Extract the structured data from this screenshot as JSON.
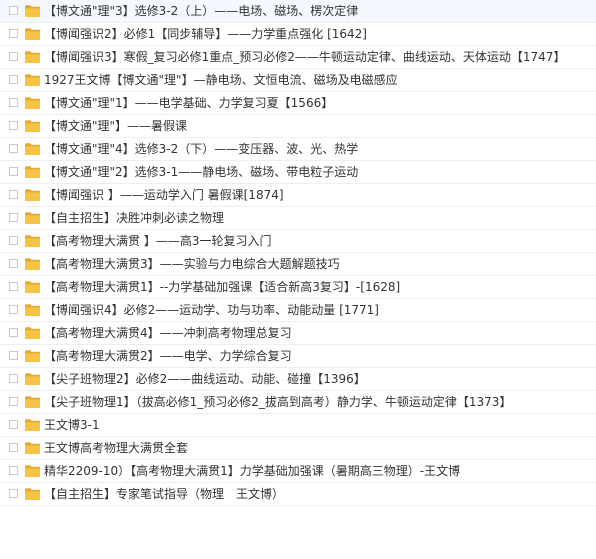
{
  "accent_colors": {
    "folder": "#f5c444",
    "folder_dark": "#e6a92f",
    "text": "#333333",
    "divider": "#eeeeee"
  },
  "file_list": {
    "items": [
      {
        "icon": "folder-icon",
        "label": "【博文通\"理\"3】选修3-2（上）——电场、磁场、楞次定律"
      },
      {
        "icon": "folder-icon",
        "label": "【博闻强识2】必修1【同步辅导】——力学重点强化 [1642]"
      },
      {
        "icon": "folder-icon",
        "label": "【博闻强识3】寒假_复习必修1重点_预习必修2——牛顿运动定律、曲线运动、天体运动【1747】"
      },
      {
        "icon": "folder-icon",
        "label": "1927王文博【博文通\"理\"】—静电场、文恒电流、磁场及电磁感应"
      },
      {
        "icon": "folder-icon",
        "label": "【博文通\"理\"1】——电学基础、力学复习夏【1566】"
      },
      {
        "icon": "folder-icon",
        "label": "【博文通\"理\"】——暑假课"
      },
      {
        "icon": "folder-icon",
        "label": "【博文通\"理\"4】选修3-2（下）——变压器、波、光、热学"
      },
      {
        "icon": "folder-icon",
        "label": "【博文通\"理\"2】选修3-1——静电场、磁场、带电粒子运动"
      },
      {
        "icon": "folder-icon",
        "label": "【博闻强识 】——运动学入门 暑假课[1874]"
      },
      {
        "icon": "folder-icon",
        "label": "【自主招生】决胜冲刺必读之物理"
      },
      {
        "icon": "folder-icon",
        "label": "【高考物理大满贯 】——高3一轮复习入门"
      },
      {
        "icon": "folder-icon",
        "label": "【高考物理大满贯3】——实验与力电综合大题解题技巧"
      },
      {
        "icon": "folder-icon",
        "label": "【高考物理大满贯1】--力学基础加强课【适合新高3复习】-[1628]"
      },
      {
        "icon": "folder-icon",
        "label": "【博闻强识4】必修2——运动学、功与功率、动能动量 [1771]"
      },
      {
        "icon": "folder-icon",
        "label": "【高考物理大满贯4】——冲刺高考物理总复习"
      },
      {
        "icon": "folder-icon",
        "label": "【高考物理大满贯2】——电学、力学综合复习"
      },
      {
        "icon": "folder-icon",
        "label": "【尖子班物理2】必修2——曲线运动、动能、碰撞【1396】"
      },
      {
        "icon": "folder-icon",
        "label": "【尖子班物理1】（拔高必修1_预习必修2_拔高到高考）静力学、牛顿运动定律【1373】"
      },
      {
        "icon": "folder-icon",
        "label": "王文博3-1"
      },
      {
        "icon": "folder-icon",
        "label": "王文博高考物理大满贯全套"
      },
      {
        "icon": "folder-icon",
        "label": "精华2209-10）【高考物理大满贯1】力学基础加强课（暑期高三物理）-王文博"
      },
      {
        "icon": "folder-icon",
        "label": "【自主招生】专家笔试指导（物理　王文博）"
      }
    ]
  }
}
